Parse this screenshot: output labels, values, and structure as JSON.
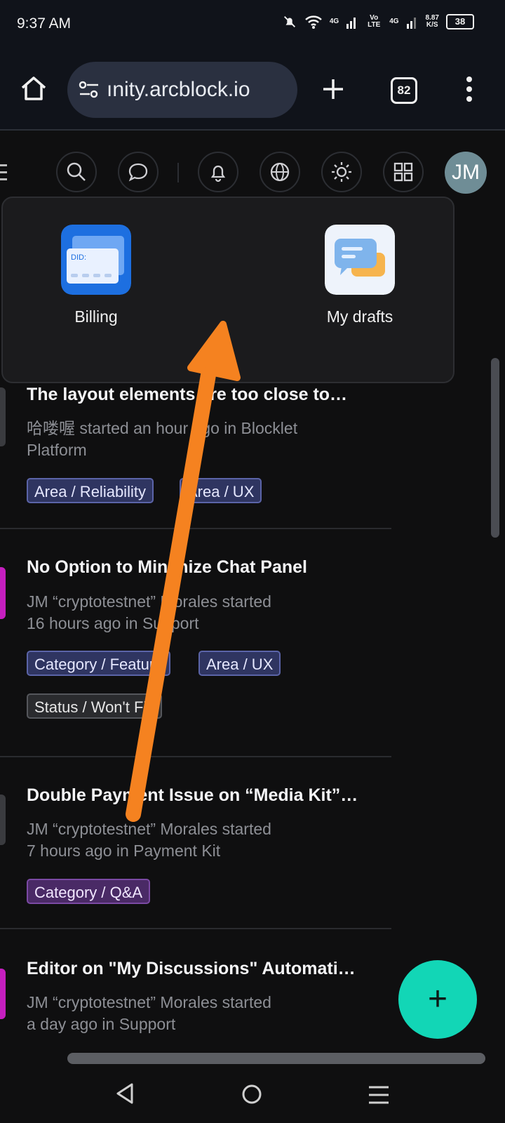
{
  "status_bar": {
    "time": "9:37 AM",
    "network_4g_1": "4G",
    "volte": "Vo LTE",
    "network_4g_2": "4G",
    "speed_value": "8.87",
    "speed_unit": "K/S",
    "battery": "38"
  },
  "browser": {
    "url": "ınity.arcblock.io",
    "tab_count": "82"
  },
  "user": {
    "initials": "JM"
  },
  "apps_menu": {
    "items": [
      {
        "label": "Billing",
        "icon": "billing-did-card-icon",
        "icon_text": "DID:"
      },
      {
        "label": "My drafts",
        "icon": "drafts-chat-bubbles-icon"
      }
    ]
  },
  "posts": [
    {
      "title": "The layout elements are too close to…",
      "meta_line1": "哈喽喔 started an hour ago in Blocklet",
      "meta_line2": "Platform",
      "tags": [
        {
          "label": "Area / Reliability",
          "style": "blue"
        },
        {
          "label": "Area / UX",
          "style": "blue"
        }
      ]
    },
    {
      "title": "No Option to Minimize Chat Panel",
      "meta_line1": "JM “cryptotestnet” Morales started",
      "meta_line2": "16 hours ago in Support",
      "tags": [
        {
          "label": "Category / Feature",
          "style": "blue"
        },
        {
          "label": "Area / UX",
          "style": "blue"
        },
        {
          "label": "Status / Won't Fix",
          "style": "gray"
        }
      ]
    },
    {
      "title": "Double Payment Issue on “Media Kit”…",
      "meta_line1": "JM “cryptotestnet” Morales started",
      "meta_line2": "7 hours ago in Payment Kit",
      "tags": [
        {
          "label": "Category / Q&A",
          "style": "purple"
        }
      ]
    },
    {
      "title": "Editor on \"My Discussions\" Automati…",
      "meta_line1": "JM “cryptotestnet” Morales started",
      "meta_line2": "a day ago in Support",
      "tags": []
    }
  ],
  "fab": {
    "label": "+"
  },
  "colors": {
    "accent_fab": "#12d6b6",
    "annotation_arrow": "#f58220",
    "tag_blue": "#2f3561",
    "tag_purple": "#4a2a66"
  }
}
